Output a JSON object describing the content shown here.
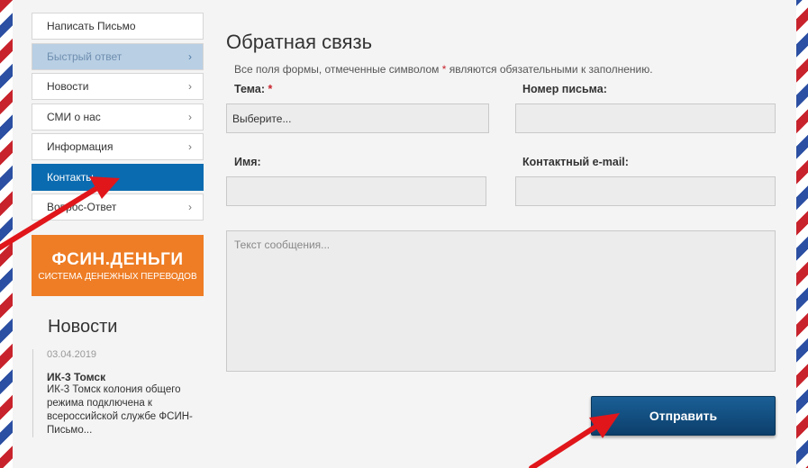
{
  "sidebar": {
    "items": [
      {
        "label": "Написать Письмо"
      },
      {
        "label": "Быстрый ответ"
      },
      {
        "label": "Новости"
      },
      {
        "label": "СМИ о нас"
      },
      {
        "label": "Информация"
      },
      {
        "label": "Контакты"
      },
      {
        "label": "Вопрос-Ответ"
      }
    ],
    "chevron": "›"
  },
  "banner": {
    "title": "ФСИН.ДЕНЬГИ",
    "subtitle": "СИСТЕМА ДЕНЕЖНЫХ ПЕРЕВОДОВ"
  },
  "news": {
    "heading": "Новости",
    "items": [
      {
        "date": "03.04.2019",
        "title": "ИК-3 Томск",
        "text": "ИК-3 Томск колония общего режима подключена к всероссийской службе ФСИН-Письмо..."
      }
    ]
  },
  "form": {
    "title": "Обратная связь",
    "note_before": "Все поля формы, отмеченные символом",
    "note_star": "*",
    "note_after": "являются обязательными к заполнению.",
    "subject_label": "Тема:",
    "required_mark": "*",
    "subject_placeholder": "Выберите...",
    "letter_number_label": "Номер письма:",
    "name_label": "Имя:",
    "email_label": "Контактный e-mail:",
    "message_placeholder": "Текст сообщения...",
    "submit_label": "Отправить"
  },
  "colors": {
    "active": "#0b6bb0",
    "banner": "#ee7d25",
    "arrow": "#e0161b",
    "button": "#0c3f6b"
  }
}
